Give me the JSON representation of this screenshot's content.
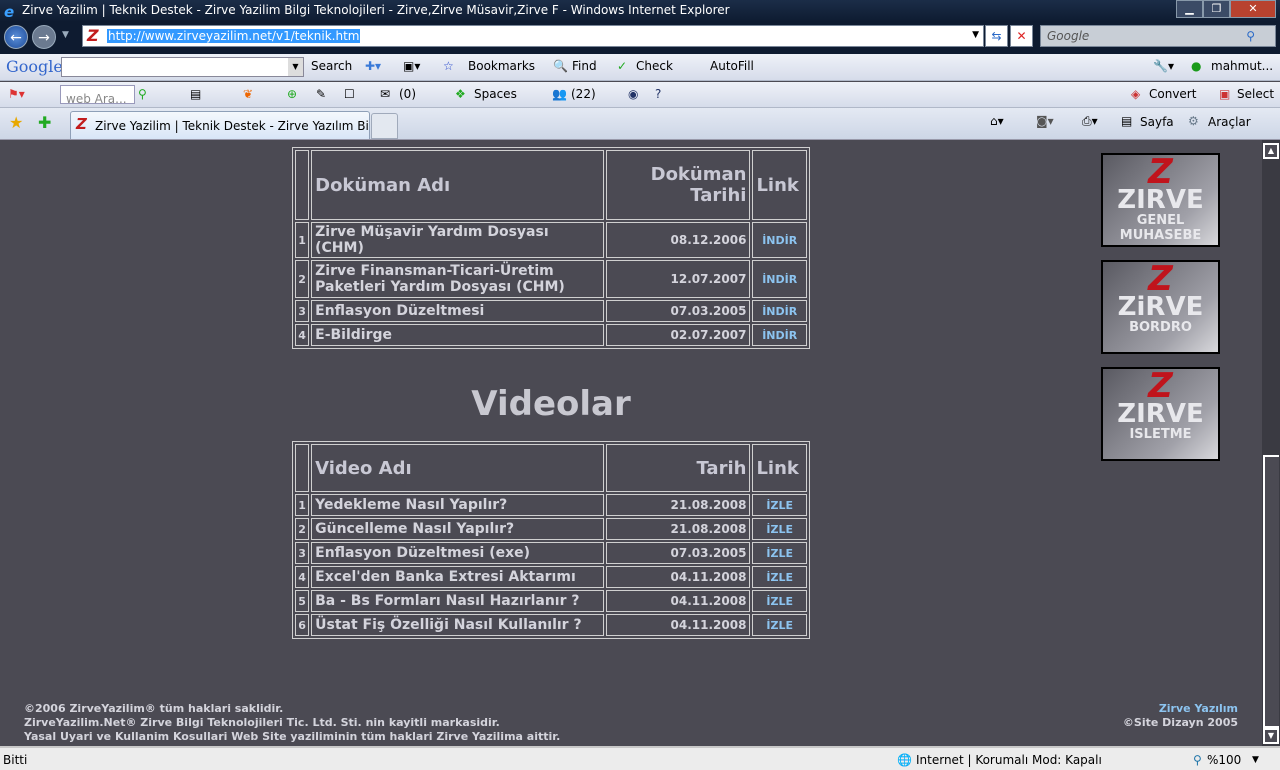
{
  "window": {
    "title": "Zirve Yazilim | Teknik Destek - Zirve Yazilim Bilgi Teknolojileri - Zirve,Zirve Müsavir,Zirve F - Windows Internet Explorer"
  },
  "address": {
    "url": "http://www.zirveyazilim.net/v1/teknik.htm",
    "search_placeholder": "Google"
  },
  "google_toolbar": {
    "logo": "Google",
    "search": "Search",
    "bookmarks": "Bookmarks",
    "find": "Find",
    "check": "Check",
    "autofill": "AutoFill",
    "user": "mahmut..."
  },
  "live_toolbar": {
    "search_placeholder": "web Ara...",
    "mail_count": "(0)",
    "spaces": "Spaces",
    "contacts": "(22)",
    "convert": "Convert",
    "select": "Select"
  },
  "tabs": {
    "active": "Zirve Yazilim | Teknik Destek - Zirve Yazılım Bilgi ...",
    "page": "Sayfa",
    "tools": "Araçlar"
  },
  "docs": {
    "headers": [
      "Doküman Adı",
      "Doküman Tarihi",
      "Link"
    ],
    "rows": [
      {
        "n": "1",
        "name": "Zirve Müşavir Yardım Dosyası (CHM)",
        "date": "08.12.2006",
        "link": "İNDİR"
      },
      {
        "n": "2",
        "name": "Zirve Finansman-Ticari-Üretim Paketleri Yardım Dosyası (CHM)",
        "date": "12.07.2007",
        "link": "İNDİR"
      },
      {
        "n": "3",
        "name": "Enflasyon Düzeltmesi",
        "date": "07.03.2005",
        "link": "İNDİR"
      },
      {
        "n": "4",
        "name": "E-Bildirge",
        "date": "02.07.2007",
        "link": "İNDİR"
      }
    ]
  },
  "videos": {
    "title": "Videolar",
    "headers": [
      "Video Adı",
      "Tarih",
      "Link"
    ],
    "rows": [
      {
        "n": "1",
        "name": "Yedekleme Nasıl Yapılır?",
        "date": "21.08.2008",
        "link": "İZLE"
      },
      {
        "n": "2",
        "name": "Güncelleme Nasıl Yapılır?",
        "date": "21.08.2008",
        "link": "İZLE"
      },
      {
        "n": "3",
        "name": "Enflasyon Düzeltmesi (exe)",
        "date": "07.03.2005",
        "link": "İZLE"
      },
      {
        "n": "4",
        "name": "Excel'den Banka Extresi Aktarımı",
        "date": "04.11.2008",
        "link": "İZLE"
      },
      {
        "n": "5",
        "name": "Ba - Bs Formları Nasıl Hazırlanır ?",
        "date": "04.11.2008",
        "link": "İZLE"
      },
      {
        "n": "6",
        "name": "Üstat Fiş Özelliği Nasıl Kullanılır ?",
        "date": "04.11.2008",
        "link": "İZLE"
      }
    ]
  },
  "banners": [
    {
      "z": "Z",
      "brand": "ZIRVE",
      "lines": [
        "GENEL",
        "MUHASEBE"
      ]
    },
    {
      "z": "Z",
      "brand": "ZiRVE",
      "lines": [
        "BORDRO"
      ]
    },
    {
      "z": "Z",
      "brand": "ZIRVE",
      "lines": [
        "ISLETME"
      ]
    }
  ],
  "footer": {
    "left": [
      "©2006 ZirveYazilim® tüm haklari saklidir.",
      "ZirveYazilim.Net® Zirve Bilgi Teknolojileri Tic. Ltd. Sti. nin kayitli markasidir.",
      "Yasal Uyari ve Kullanim Kosullari Web Site yaziliminin tüm haklari Zirve Yazilima aittir."
    ],
    "right_link": "Zirve Yazılım",
    "right_text": "©Site Dizayn 2005"
  },
  "status": {
    "text": "Bitti",
    "zone": "Internet | Korumalı Mod: Kapalı",
    "zoom": "%100"
  },
  "colors": {
    "page_bg": "#4b4a53",
    "link": "#8cc4f0",
    "text": "#d4d4dc"
  }
}
